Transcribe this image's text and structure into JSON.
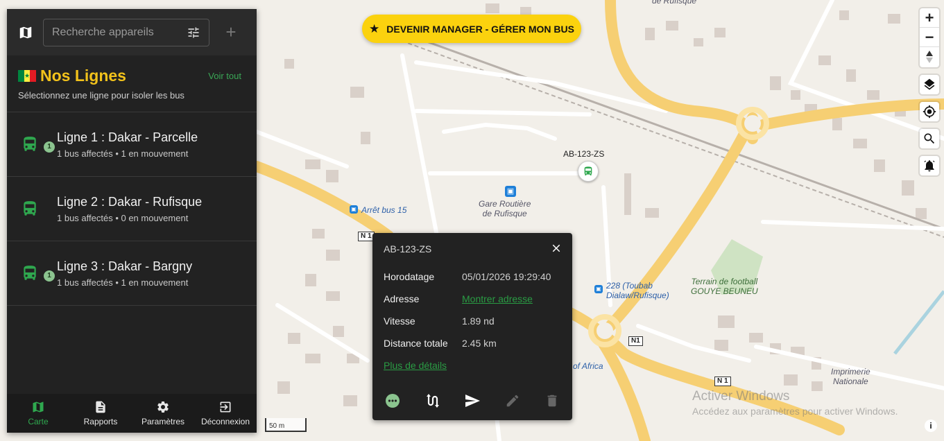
{
  "search": {
    "placeholder": "Recherche appareils"
  },
  "banner": {
    "label": "DEVENIR MANAGER - GÉRER MON BUS"
  },
  "lines_panel": {
    "title": "Nos Lignes",
    "view_all": "Voir tout",
    "subtitle": "Sélectionnez une ligne pour isoler les bus",
    "items": [
      {
        "name": "Ligne 1 : Dakar - Parcelle",
        "stats": "1 bus affectés • 1 en mouvement",
        "badge": "1"
      },
      {
        "name": "Ligne 2 : Dakar - Rufisque",
        "stats": "1 bus affectés • 0 en mouvement",
        "badge": ""
      },
      {
        "name": "Ligne 3 : Dakar - Bargny",
        "stats": "1 bus affectés • 1 en mouvement",
        "badge": "1"
      }
    ]
  },
  "nav": {
    "items": [
      {
        "label": "Carte",
        "icon": "map-icon"
      },
      {
        "label": "Rapports",
        "icon": "description-icon"
      },
      {
        "label": "Paramètres",
        "icon": "gear-icon"
      },
      {
        "label": "Déconnexion",
        "icon": "logout-icon"
      }
    ]
  },
  "popup": {
    "title": "AB-123-ZS",
    "rows": [
      {
        "key": "Horodatage",
        "value": "05/01/2026 19:29:40"
      },
      {
        "key": "Adresse",
        "value": "Montrer adresse"
      },
      {
        "key": "Vitesse",
        "value": "1.89 nd"
      },
      {
        "key": "Distance totale",
        "value": "2.45 km"
      }
    ],
    "details_link": "Plus de détails"
  },
  "map": {
    "vehicle_label": "AB-123-ZS",
    "labels": {
      "gare": "Gare Routière\nde Rufisque",
      "arret": "Arrêt bus 15",
      "stop228": "228 (Toubab\nDialaw/Rufisque)",
      "terrain": "Terrain de football\nGOUYE BEUNEU",
      "imprimerie": "Imprimerie\nNationale",
      "africa": "of Africa",
      "top": "de Rufisque"
    },
    "shields": [
      "N 1",
      "N1",
      "N 1"
    ],
    "scale": "50 m"
  },
  "watermark": {
    "line1": "Activer Windows",
    "line2": "Accédez aux paramètres pour activer Windows."
  },
  "colors": {
    "accent_green": "#2fa84f",
    "title_yellow": "#f2c21b",
    "banner_yellow": "#fbd20e",
    "panel_bg": "#222222"
  }
}
